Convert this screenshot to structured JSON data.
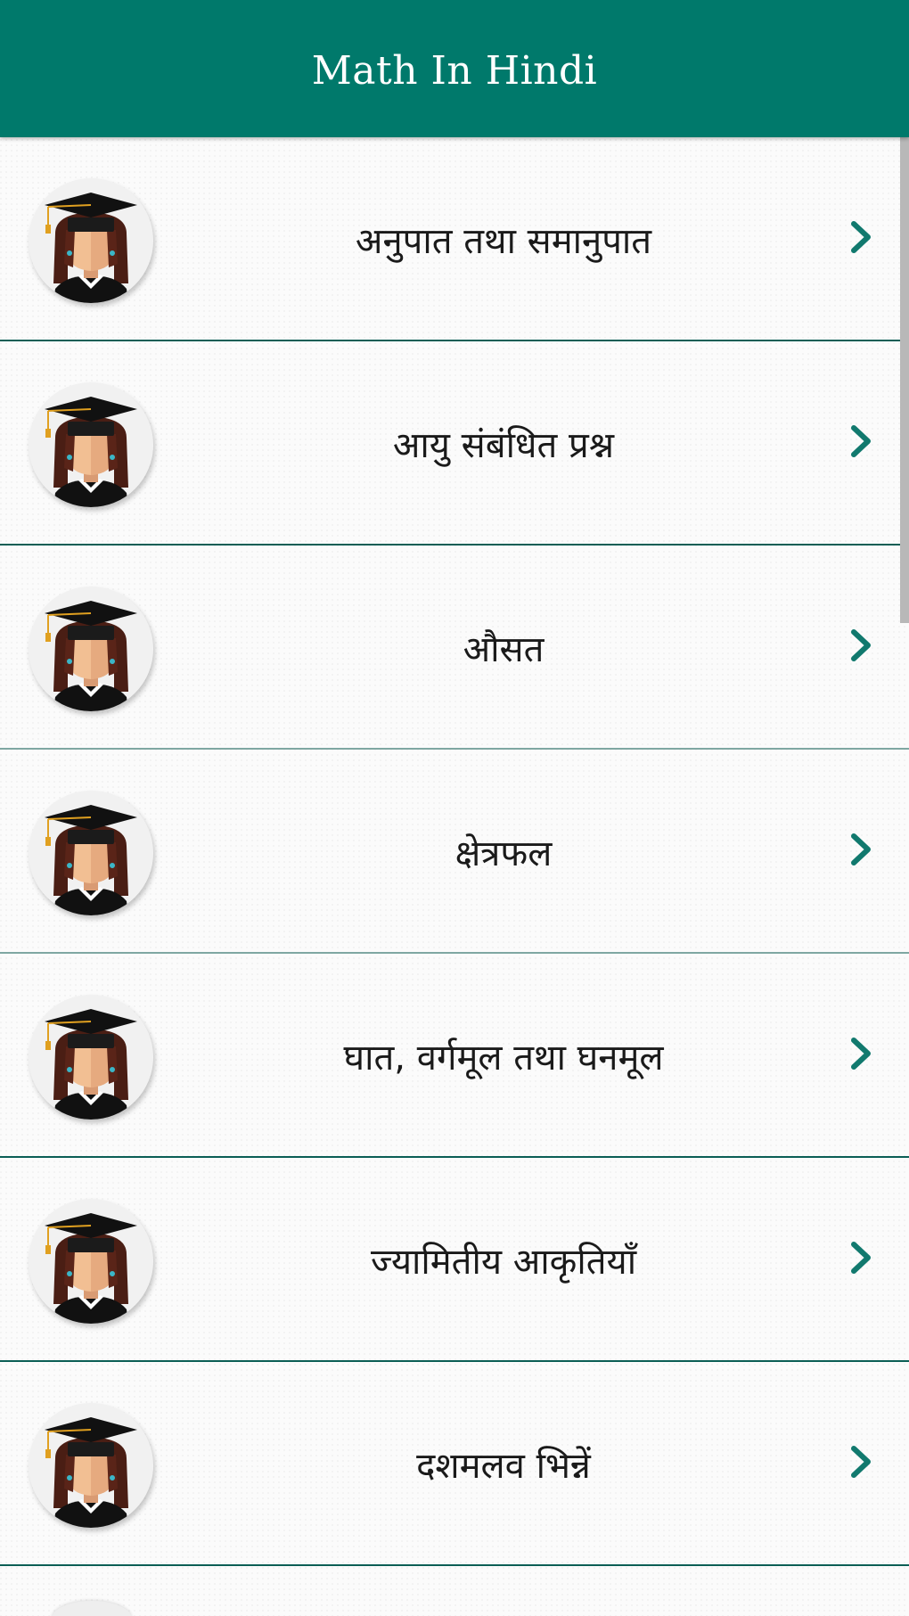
{
  "app": {
    "title": "Math In Hindi"
  },
  "colors": {
    "primary": "#00796b",
    "accent_chevron": "#11796e",
    "divider": "#0b5e55"
  },
  "topics": [
    {
      "label": "अनुपात तथा समानुपात",
      "icon": "graduate-avatar-icon"
    },
    {
      "label": "आयु संबंधित प्रश्न",
      "icon": "graduate-avatar-icon"
    },
    {
      "label": "औसत",
      "icon": "graduate-avatar-icon"
    },
    {
      "label": "क्षेत्रफल",
      "icon": "graduate-avatar-icon"
    },
    {
      "label": "घात, वर्गमूल तथा घनमूल",
      "icon": "graduate-avatar-icon"
    },
    {
      "label": "ज्यामितीय आकृतियाँ",
      "icon": "graduate-avatar-icon"
    },
    {
      "label": "दशमलव भिन्नें",
      "icon": "graduate-avatar-icon"
    }
  ]
}
